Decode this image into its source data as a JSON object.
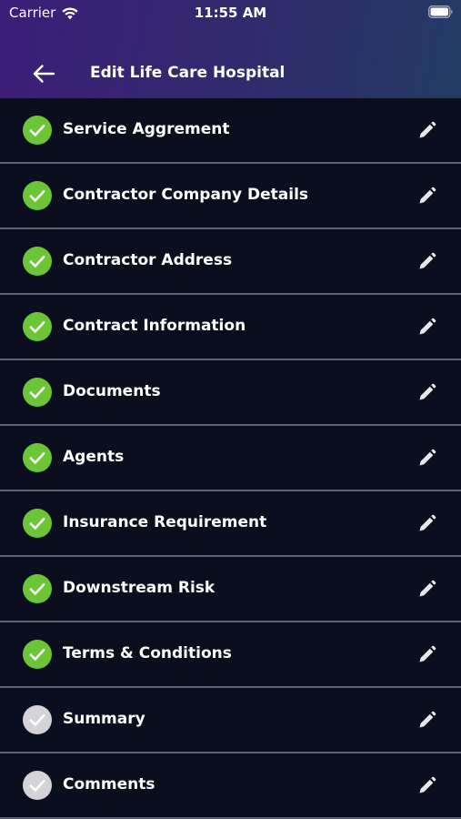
{
  "status_bar": {
    "carrier": "Carrier",
    "time": "11:55 AM"
  },
  "nav": {
    "title": "Edit Life Care Hospital"
  },
  "colors": {
    "done": "#6cc437",
    "pending": "#d4d4d8",
    "background": "#0b0e1e",
    "divider": "#5d6070"
  },
  "sections": [
    {
      "label": "Service Aggrement",
      "status": "done"
    },
    {
      "label": "Contractor Company Details",
      "status": "done"
    },
    {
      "label": "Contractor Address",
      "status": "done"
    },
    {
      "label": "Contract Information",
      "status": "done"
    },
    {
      "label": "Documents",
      "status": "done"
    },
    {
      "label": "Agents",
      "status": "done"
    },
    {
      "label": "Insurance Requirement",
      "status": "done"
    },
    {
      "label": "Downstream Risk",
      "status": "done"
    },
    {
      "label": "Terms & Conditions",
      "status": "done"
    },
    {
      "label": "Summary",
      "status": "pending"
    },
    {
      "label": "Comments",
      "status": "pending"
    }
  ]
}
